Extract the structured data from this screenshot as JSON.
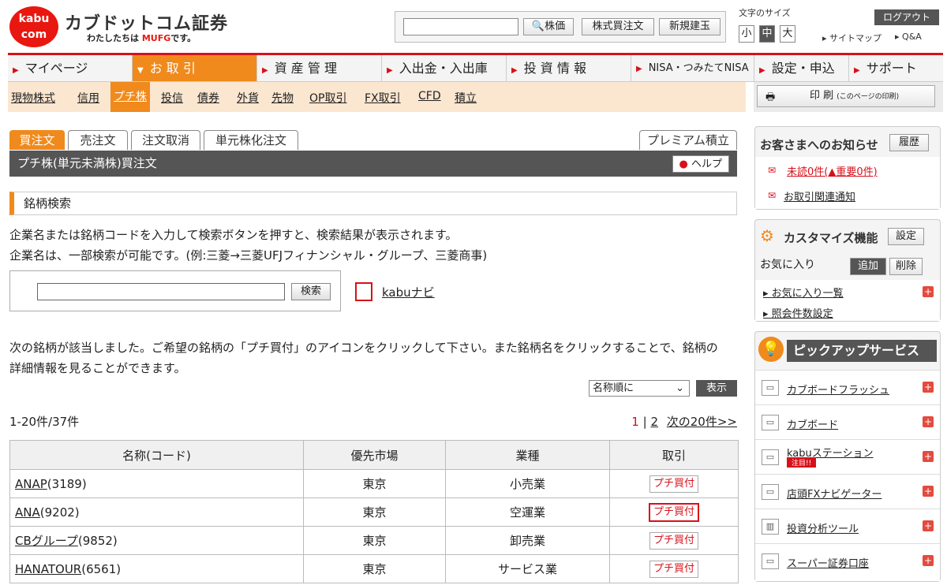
{
  "header": {
    "logo_text_1": "kabu",
    "logo_text_2": "com",
    "brand": "カブドットコム証券",
    "tagline_prefix": "わたしたちは",
    "tagline_mufg": "MUFG",
    "tagline_suffix": "です。",
    "search_buttons": [
      "株価",
      "株式買注文",
      "新規建玉"
    ],
    "font_size_label": "文字のサイズ",
    "font_sizes": [
      "小",
      "中",
      "大"
    ],
    "logout": "ログアウト",
    "sitemap": "サイトマップ",
    "qa": "Q&A"
  },
  "nav": {
    "items": [
      "マイページ",
      "お 取 引",
      "資 産 管 理",
      "入出金・入出庫",
      "投 資 情 報",
      "NISA・つみたてNISA",
      "設定・申込",
      "サポート"
    ],
    "active_index": 1
  },
  "subnav": {
    "items": [
      "現物株式",
      "信用",
      "プチ株",
      "投信",
      "債券",
      "外貨",
      "先物",
      "OP取引",
      "FX取引",
      "CFD",
      "積立"
    ],
    "active": "プチ株",
    "print_label": "印 刷",
    "print_note": "(このページの印刷)"
  },
  "tabs": [
    "買注文",
    "売注文",
    "注文取消",
    "単元株化注文"
  ],
  "premium_button": "プレミアム積立",
  "page_title": "プチ株(単元未満株)買注文",
  "help": "ヘルプ",
  "section_title": "銘柄検索",
  "desc_line1": "企業名または銘柄コードを入力して検索ボタンを押すと、検索結果が表示されます。",
  "desc_line2": "企業名は、一部検索が可能です。(例:三菱→三菱UFJフィナンシャル・グループ、三菱商事)",
  "search_button": "検索",
  "kabu_navi": "kabuナビ",
  "result_line1": "次の銘柄が該当しました。ご希望の銘柄の「プチ買付」のアイコンをクリックして下さい。また銘柄名をクリックすることで、銘柄の",
  "result_line2": "詳細情報を見ることができます。",
  "sort_value": "名称順に",
  "show_button": "表示",
  "count": "1-20件/37件",
  "pager": {
    "current": "1",
    "sep": "|",
    "page2": "2",
    "next": "次の20件>>"
  },
  "table": {
    "headers": [
      "名称(コード)",
      "優先市場",
      "業種",
      "取引"
    ],
    "rows": [
      {
        "name": "ANAP",
        "code": "(3189)",
        "market": "東京",
        "industry": "小売業",
        "action": "プチ買付"
      },
      {
        "name": "ANA",
        "code": "(9202)",
        "market": "東京",
        "industry": "空運業",
        "action": "プチ買付"
      },
      {
        "name": "CBグループ",
        "code": "(9852)",
        "market": "東京",
        "industry": "卸売業",
        "action": "プチ買付"
      },
      {
        "name": "HANATOUR",
        "code": "(6561)",
        "market": "東京",
        "industry": "サービス業",
        "action": "プチ買付"
      }
    ]
  },
  "sidebar": {
    "notice_title": "お客さまへのお知らせ",
    "history": "履歴",
    "unread": "未読0件(",
    "important": "重要0件)",
    "trade_notice": "お取引関連通知",
    "customize_title": "カスタマイズ機能",
    "settings": "設定",
    "favorites": "お気に入り",
    "add": "追加",
    "delete": "削除",
    "fav_list": "お気に入り一覧",
    "query_settings": "照会件数設定",
    "pickup_title": "ピックアップサービス",
    "services": [
      "カブボードフラッシュ",
      "カブボード",
      "kabuステーション",
      "店頭FXナビゲーター",
      "投資分析ツール",
      "スーパー証券口座"
    ],
    "new_badge": "注目!!"
  }
}
